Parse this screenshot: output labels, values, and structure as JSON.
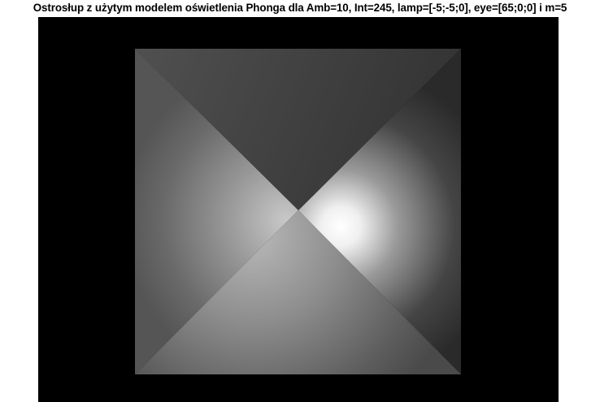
{
  "figure": {
    "title": "Ostrosłup z użytym modelem oświetlenia Phonga dla Amb=10, Int=245, lamp=[-5;-5;0], eye=[65;0;0] i m=5"
  },
  "scene": {
    "object": "pyramid",
    "background_color": "#000000"
  }
}
